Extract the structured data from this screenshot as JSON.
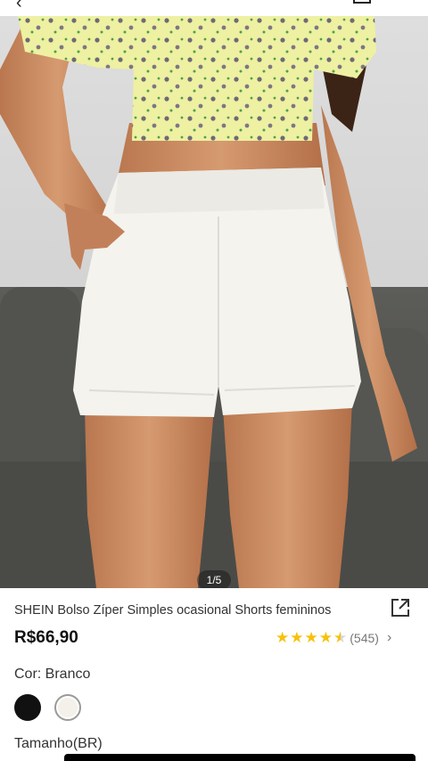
{
  "header": {
    "back_icon": "chevron-left-icon",
    "bag_icon": "shopping-bag-icon"
  },
  "gallery": {
    "pager": "1/5",
    "image": "model-wearing-white-shorts-photo"
  },
  "product": {
    "title": "SHEIN Bolso Zíper Simples ocasional Shorts femininos",
    "price": "R$66,90",
    "rating": 4.5,
    "review_count": "(545)",
    "color_label": "Cor: Branco",
    "size_label": "Tamanho(BR)",
    "swatches": [
      {
        "name": "black",
        "color": "#111111"
      },
      {
        "name": "white",
        "color": "#f4f0ea",
        "selected": true
      }
    ],
    "accent_star_color": "#f5c20b"
  }
}
